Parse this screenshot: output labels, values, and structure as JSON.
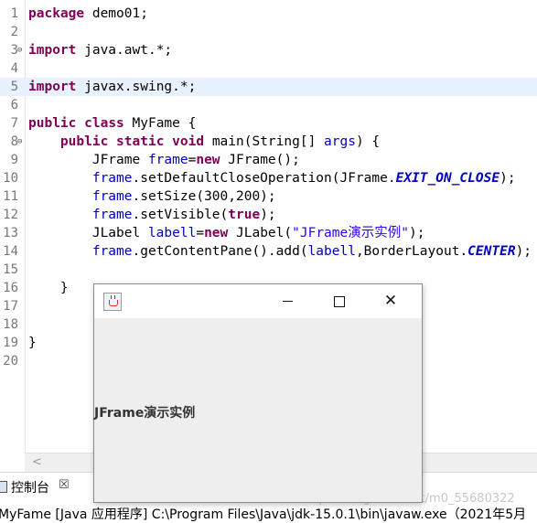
{
  "editor": {
    "current_line": 5,
    "lines": [
      {
        "num": "1",
        "tokens": [
          {
            "t": "package",
            "c": "kw"
          },
          {
            "t": " demo01;",
            "c": ""
          }
        ]
      },
      {
        "num": "2",
        "tokens": []
      },
      {
        "num": "3",
        "fold": true,
        "tokens": [
          {
            "t": "import",
            "c": "kw"
          },
          {
            "t": " java.awt.*;",
            "c": ""
          }
        ]
      },
      {
        "num": "4",
        "tokens": []
      },
      {
        "num": "5",
        "tokens": [
          {
            "t": "import",
            "c": "kw"
          },
          {
            "t": " javax.swing.*;",
            "c": ""
          }
        ]
      },
      {
        "num": "6",
        "tokens": []
      },
      {
        "num": "7",
        "tokens": [
          {
            "t": "public",
            "c": "kw"
          },
          {
            "t": " ",
            "c": ""
          },
          {
            "t": "class",
            "c": "kw"
          },
          {
            "t": " MyFame {",
            "c": ""
          }
        ]
      },
      {
        "num": "8",
        "fold": true,
        "tokens": [
          {
            "t": "    ",
            "c": ""
          },
          {
            "t": "public",
            "c": "kw"
          },
          {
            "t": " ",
            "c": ""
          },
          {
            "t": "static",
            "c": "kw"
          },
          {
            "t": " ",
            "c": ""
          },
          {
            "t": "void",
            "c": "kw"
          },
          {
            "t": " main(String[] ",
            "c": ""
          },
          {
            "t": "args",
            "c": "var"
          },
          {
            "t": ") {",
            "c": ""
          }
        ]
      },
      {
        "num": "9",
        "tokens": [
          {
            "t": "        JFrame ",
            "c": ""
          },
          {
            "t": "frame",
            "c": "var"
          },
          {
            "t": "=",
            "c": ""
          },
          {
            "t": "new",
            "c": "kw"
          },
          {
            "t": " JFrame();",
            "c": ""
          }
        ]
      },
      {
        "num": "10",
        "tokens": [
          {
            "t": "        ",
            "c": ""
          },
          {
            "t": "frame",
            "c": "var"
          },
          {
            "t": ".setDefaultCloseOperation(JFrame.",
            "c": ""
          },
          {
            "t": "EXIT_ON_CLOSE",
            "c": "sfld"
          },
          {
            "t": ");",
            "c": ""
          }
        ]
      },
      {
        "num": "11",
        "tokens": [
          {
            "t": "        ",
            "c": ""
          },
          {
            "t": "frame",
            "c": "var"
          },
          {
            "t": ".setSize(300,200);",
            "c": ""
          }
        ]
      },
      {
        "num": "12",
        "tokens": [
          {
            "t": "        ",
            "c": ""
          },
          {
            "t": "frame",
            "c": "var"
          },
          {
            "t": ".setVisible(",
            "c": ""
          },
          {
            "t": "true",
            "c": "kw"
          },
          {
            "t": ");",
            "c": ""
          }
        ]
      },
      {
        "num": "13",
        "tokens": [
          {
            "t": "        JLabel ",
            "c": ""
          },
          {
            "t": "labell",
            "c": "var"
          },
          {
            "t": "=",
            "c": ""
          },
          {
            "t": "new",
            "c": "kw"
          },
          {
            "t": " JLabel(",
            "c": ""
          },
          {
            "t": "\"JFrame演示实例\"",
            "c": "str"
          },
          {
            "t": ");",
            "c": ""
          }
        ]
      },
      {
        "num": "14",
        "tokens": [
          {
            "t": "        ",
            "c": ""
          },
          {
            "t": "frame",
            "c": "var"
          },
          {
            "t": ".getContentPane().add(",
            "c": ""
          },
          {
            "t": "labell",
            "c": "var"
          },
          {
            "t": ",BorderLayout.",
            "c": ""
          },
          {
            "t": "CENTER",
            "c": "sfld"
          },
          {
            "t": ");",
            "c": ""
          }
        ]
      },
      {
        "num": "15",
        "tokens": []
      },
      {
        "num": "16",
        "tokens": [
          {
            "t": "    }",
            "c": ""
          }
        ]
      },
      {
        "num": "17",
        "tokens": []
      },
      {
        "num": "18",
        "tokens": []
      },
      {
        "num": "19",
        "tokens": [
          {
            "t": "}",
            "c": ""
          }
        ]
      },
      {
        "num": "20",
        "tokens": []
      }
    ]
  },
  "scrollbar": {
    "left_arrow": "<"
  },
  "console": {
    "tab_label": "控制台",
    "tab_close": "☒",
    "status": "MyFame [Java 应用程序] C:\\Program Files\\Java\\jdk-15.0.1\\bin\\javaw.exe（2021年5月"
  },
  "jframe": {
    "label_text": "JFrame演示实例",
    "close_glyph": "✕",
    "icon": "java-icon"
  },
  "watermark": "https://blog.csdn.net/m0_55680322",
  "colors": {
    "keyword": "#7f0055",
    "field": "#0000c0",
    "string": "#2a00ff",
    "current_line": "#e8f2fe",
    "line_number": "#787878"
  }
}
